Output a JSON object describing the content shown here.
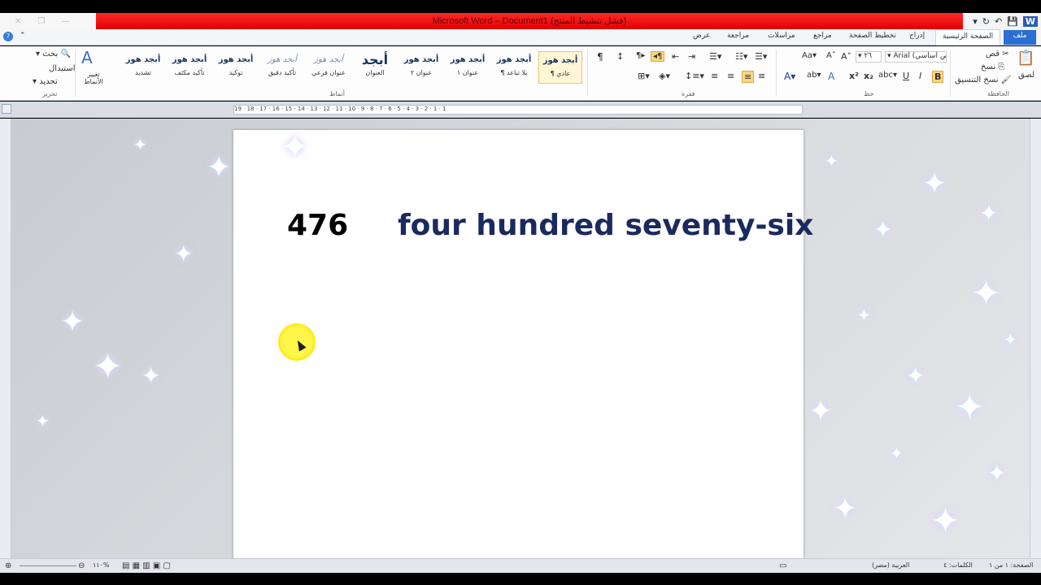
{
  "window": {
    "title": "Microsoft Word – Document1 (فشل تنشيط المنتج)"
  },
  "tabs": {
    "file": "ملف",
    "home": "الصفحة الرئيسية",
    "insert": "إدراج",
    "page_layout": "تخطيط الصفحة",
    "references": "مراجع",
    "mailings": "مراسلات",
    "review": "مراجعة",
    "view": "عرض"
  },
  "ribbon": {
    "clipboard": {
      "label": "الحافظة",
      "paste": "لصق",
      "cut": "قص",
      "copy": "نسخ",
      "format_painter": "نسخ التنسيق"
    },
    "font": {
      "label": "خط",
      "name": "Arial (نص أساسي)",
      "size": "٢٦"
    },
    "paragraph": {
      "label": "فقرة"
    },
    "styles": {
      "label": "أنماط",
      "change_styles": "تغيير الأنماط",
      "items": [
        {
          "preview": "أبجد هوز",
          "name": "¶ عادي"
        },
        {
          "preview": "أبجد هوز",
          "name": "¶ بلا تباعد"
        },
        {
          "preview": "أبجد هوز",
          "name": "عنوان ١"
        },
        {
          "preview": "أبجد هوز",
          "name": "عنوان ٢"
        },
        {
          "preview": "أبجد",
          "name": "العنوان"
        },
        {
          "preview": "أبجد هوز",
          "name": "عنوان فرعي"
        },
        {
          "preview": "أبجد هوز",
          "name": "تأكيد دقيق"
        },
        {
          "preview": "أبجد هوز",
          "name": "توكيد"
        },
        {
          "preview": "أبجد هوز",
          "name": "تأكيد مكثف"
        },
        {
          "preview": "أبجد هوز",
          "name": "تشديد"
        }
      ]
    },
    "editing": {
      "label": "تحرير",
      "find": "بحث",
      "replace": "استبدال",
      "select": "تحديد"
    }
  },
  "ruler": {
    "ticks": "19 · 18 · 17 · 16 · 15 · 14 · 13 · 12 · 11 · 10 · 9 · 8 · 7 · 6 · 5 · 4 · 3 · 2 · 1 · 1"
  },
  "document": {
    "number": "476",
    "words": "four hundred seventy-six"
  },
  "status": {
    "page": "الصفحة: ١ من ١",
    "words": "الكلمات: ٤",
    "language": "العربية (مصر)",
    "zoom": "١١٠%"
  }
}
